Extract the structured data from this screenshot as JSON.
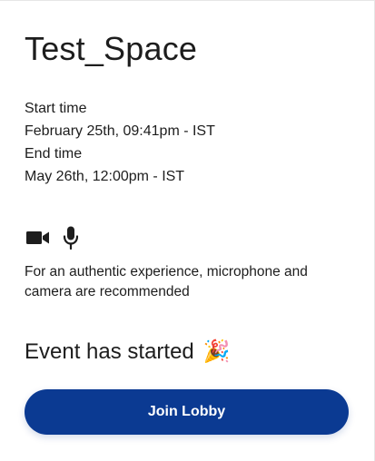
{
  "event": {
    "title": "Test_Space",
    "start_label": "Start time",
    "start_value": "February 25th, 09:41pm - IST",
    "end_label": "End time",
    "end_value": "May 26th, 12:00pm - IST"
  },
  "devices": {
    "camera_icon": "camera-icon",
    "microphone_icon": "microphone-icon",
    "recommendation": "For an authentic experience, microphone and camera are recommended"
  },
  "status": {
    "text": "Event has started",
    "emoji": "🎉",
    "emoji_icon": "party-popper-icon"
  },
  "actions": {
    "join_label": "Join Lobby"
  },
  "colors": {
    "primary": "#0b3a92",
    "text": "#1d1d1d",
    "background": "#ffffff"
  }
}
